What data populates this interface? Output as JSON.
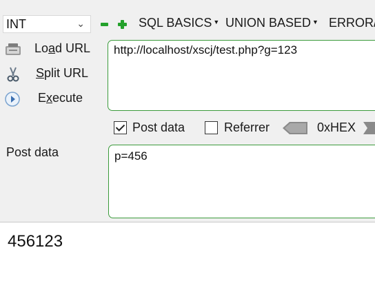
{
  "toolbar": {
    "injection_type": "INT",
    "menus": [
      "SQL BASICS",
      "UNION BASED",
      "ERROR/"
    ]
  },
  "actions": {
    "load_url": {
      "prefix": "Lo",
      "underline": "a",
      "suffix": "d URL"
    },
    "split_url": {
      "prefix": "",
      "underline": "S",
      "suffix": "plit URL"
    },
    "execute": {
      "prefix": "E",
      "underline": "x",
      "suffix": "ecute"
    }
  },
  "url_field": {
    "value": "http://localhost/xscj/test.php?g=123"
  },
  "options": {
    "post_data": {
      "label": "Post data",
      "checked": true
    },
    "referrer": {
      "label": "Referrer",
      "checked": false
    },
    "hex_label": "0xHEX"
  },
  "post": {
    "label": "Post data",
    "value": "p=456"
  },
  "result": {
    "text": "456123"
  },
  "colors": {
    "accent_green": "#24a12b",
    "field_border": "#3a9a3a",
    "panel_bg": "#f0f0f0"
  }
}
